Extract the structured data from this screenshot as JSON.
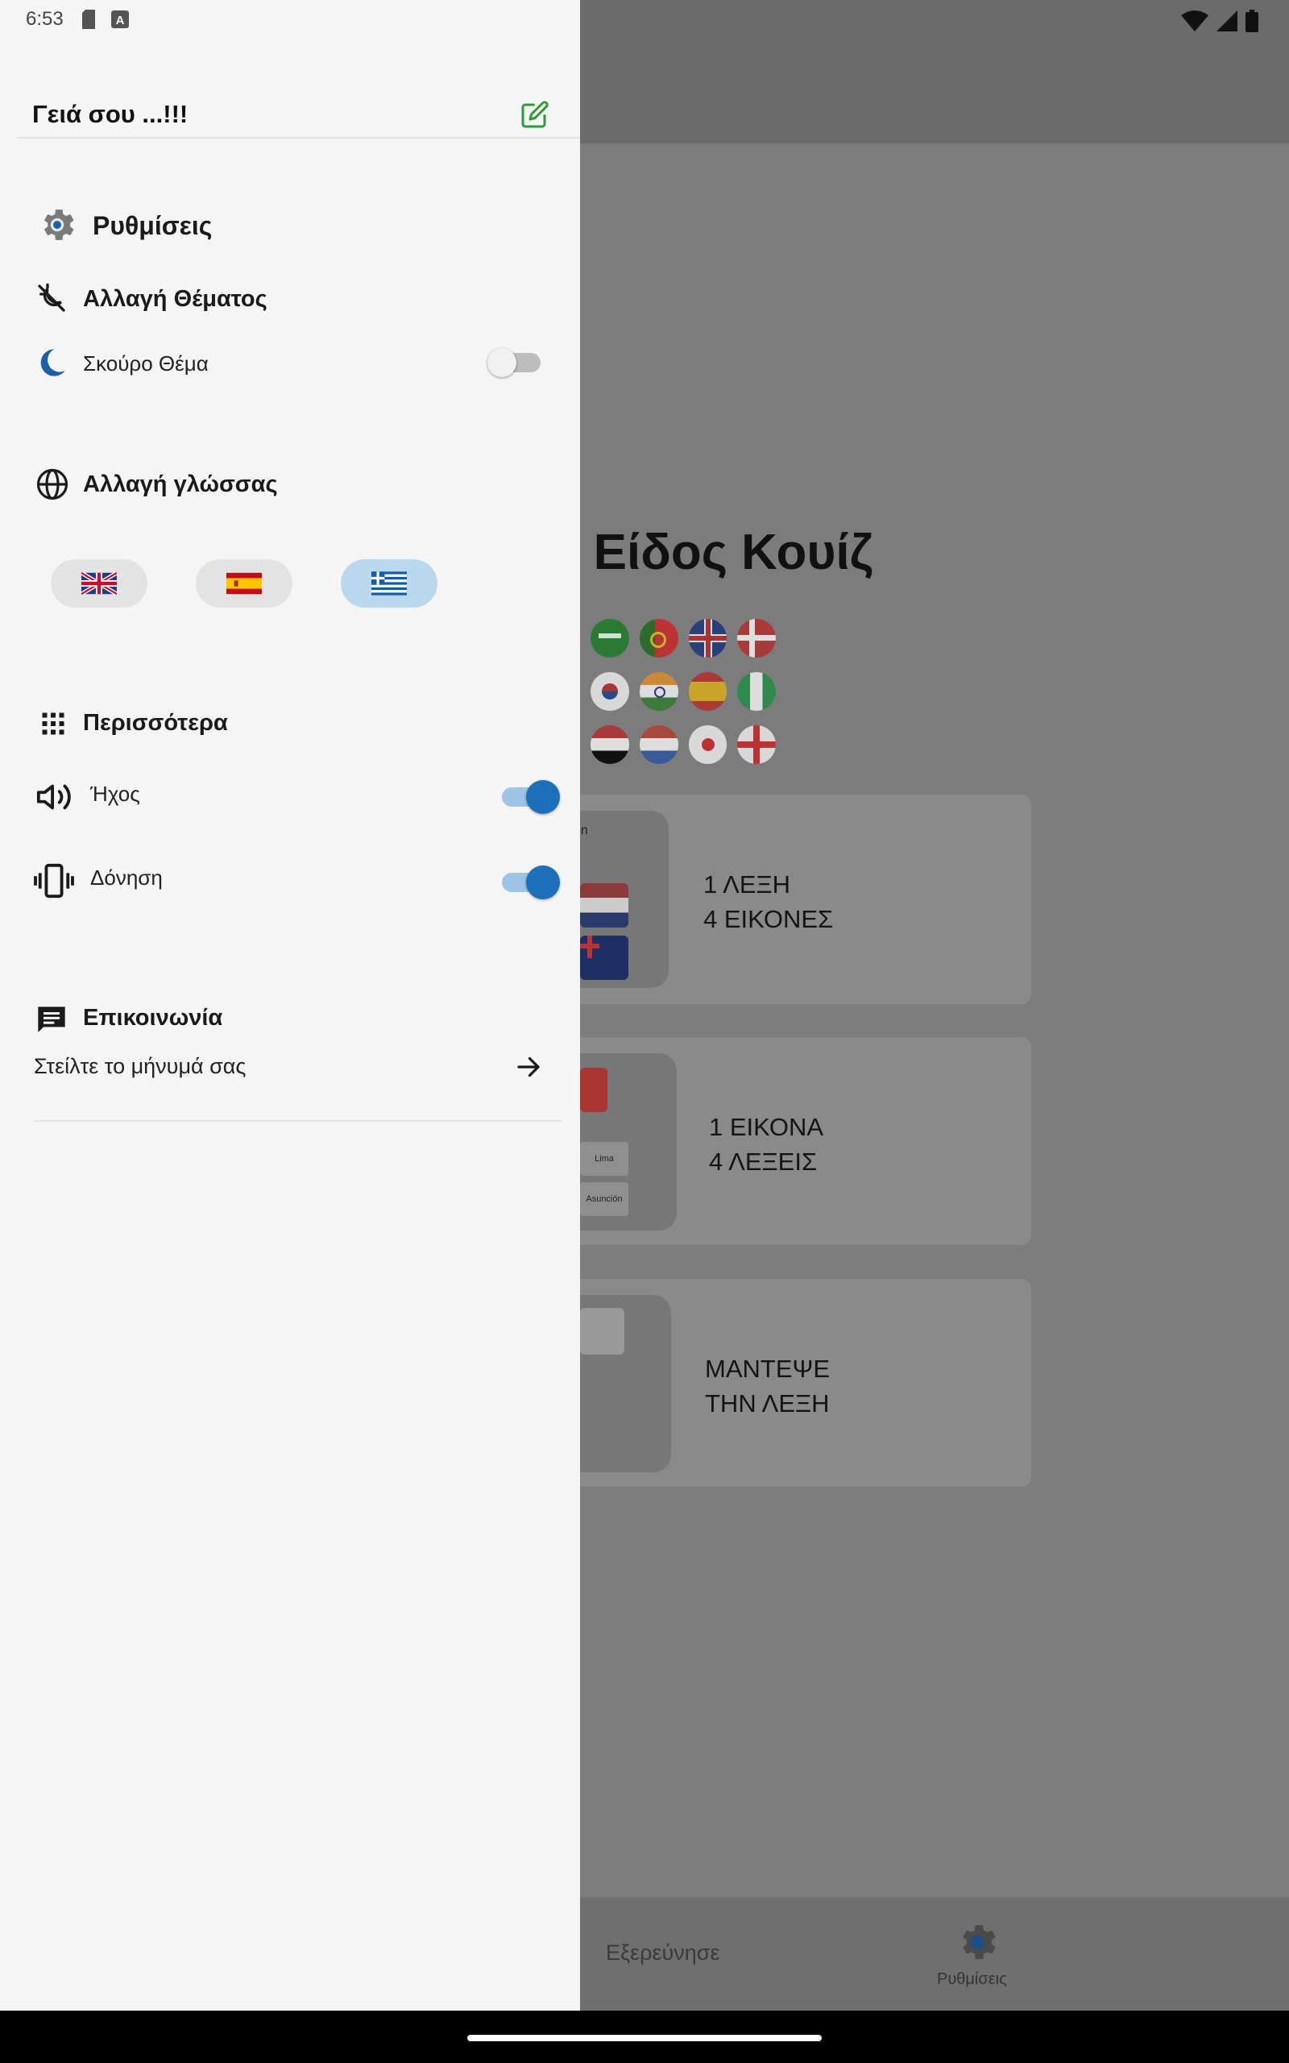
{
  "status_bar": {
    "time": "6:53"
  },
  "drawer": {
    "greeting": "Γειά σου ...!!!",
    "settings_title": "Ρυθμίσεις",
    "theme_section": "Αλλαγή Θέματος",
    "dark_theme_label": "Σκούρο Θέμα",
    "dark_theme_on": false,
    "language_section": "Αλλαγή γλώσσας",
    "languages": [
      {
        "flag": "uk-flag",
        "selected": false
      },
      {
        "flag": "spain-flag",
        "selected": false
      },
      {
        "flag": "greece-flag",
        "selected": true
      }
    ],
    "more_section": "Περισσότερα",
    "sound_label": "Ήχος",
    "sound_on": true,
    "vibration_label": "Δόνηση",
    "vibration_on": true,
    "contact_section": "Επικοινωνία",
    "contact_row_label": "Στείλτε το μήνυμά σας"
  },
  "background_app": {
    "title_fragment": "ε Είδος Κουίζ",
    "cards": [
      {
        "line1": "1 ΛΕΞΗ",
        "line2": "4 ΕΙΚΟΝΕΣ",
        "thumb_text": "on"
      },
      {
        "line1": "1 ΕΙΚΟΝΑ",
        "line2": "4 ΛΕΞΕΙΣ",
        "chips": [
          "Lima",
          "Asunción"
        ]
      },
      {
        "line1": "ΜΑΝΤΕΨΕ",
        "line2": "ΤΗΝ ΛΕΞΗ"
      }
    ],
    "nav_explore": "Εξερεύνησε",
    "nav_settings": "Ρυθμίσεις"
  },
  "colors": {
    "drawer_bg": "#f5f5f5",
    "accent_blue": "#1c6fb8",
    "edit_green": "#2e9a3a",
    "selected_lang_bg": "#b9d8ee"
  }
}
